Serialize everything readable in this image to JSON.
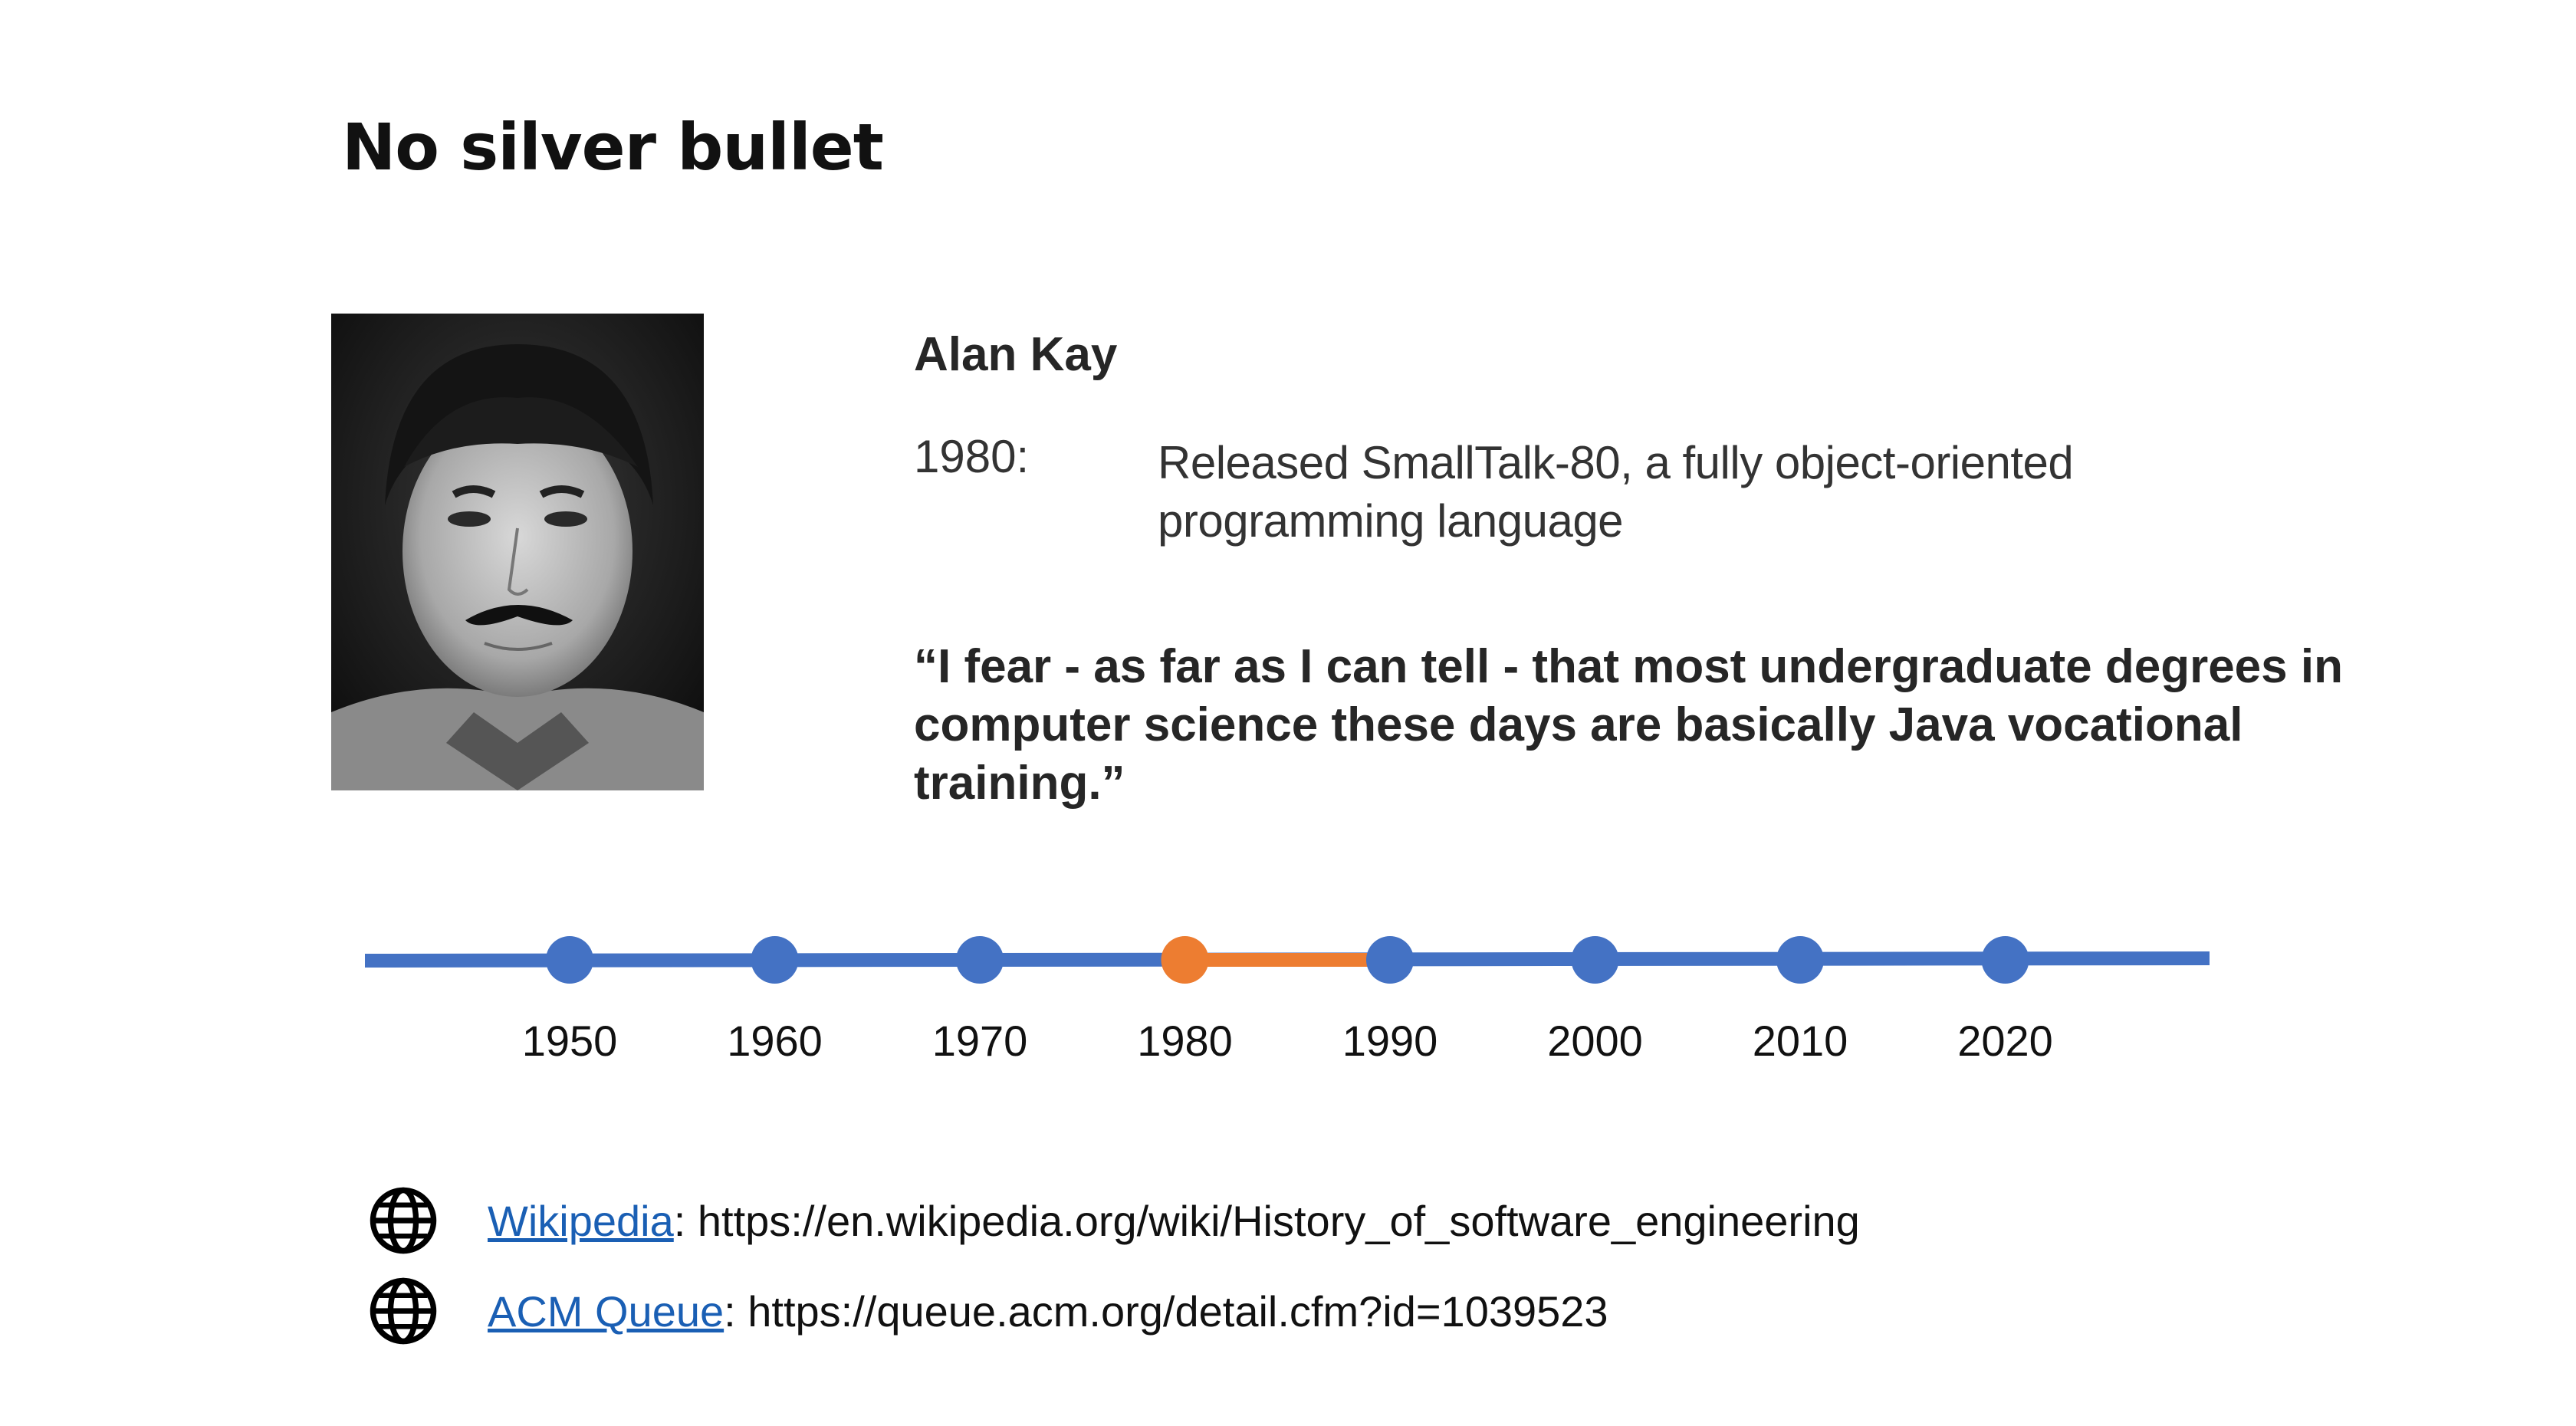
{
  "slide": {
    "title": "No silver bullet"
  },
  "person": {
    "name": "Alan Kay",
    "event_year": "1980:",
    "event_text": "Released SmallTalk-80, a fully object-oriented programming language",
    "quote": "“I fear - as far as I can tell - that most undergraduate degrees in computer science these days are basically Java vocational training.”"
  },
  "timeline": {
    "years": [
      "1950",
      "1960",
      "1970",
      "1980",
      "1990",
      "2000",
      "2010",
      "2020"
    ],
    "highlighted_year": "1980",
    "line_color": "#4472c4",
    "highlight_color": "#ed7d31"
  },
  "links": [
    {
      "icon": "globe-icon",
      "label": "Wikipedia",
      "url": "https://en.wikipedia.org/wiki/History_of_software_engineering"
    },
    {
      "icon": "globe-icon",
      "label": "ACM Queue",
      "url": "https://queue.acm.org/detail.cfm?id=1039523"
    }
  ]
}
